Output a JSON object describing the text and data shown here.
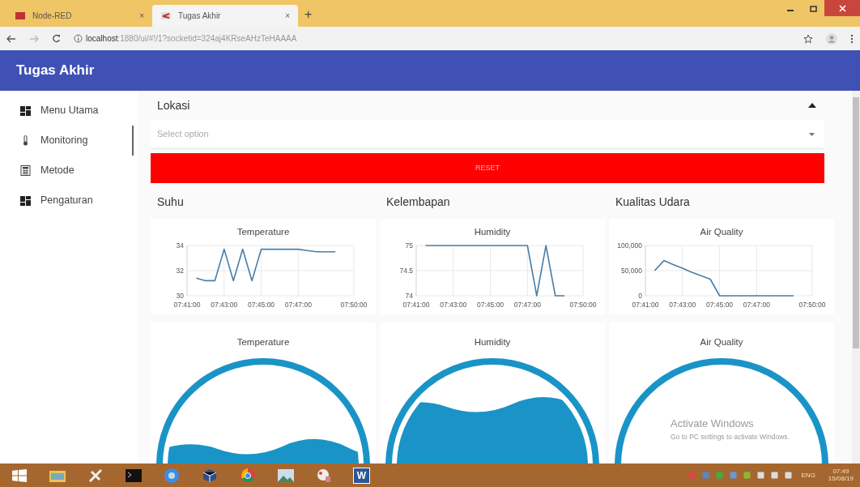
{
  "browser": {
    "tabs": [
      {
        "title": "Node-RED",
        "selected": false,
        "close": "×"
      },
      {
        "title": "Tugas Akhir",
        "selected": true,
        "close": "×"
      }
    ],
    "new_tab": "+",
    "address": {
      "host": "localhost",
      "path": ":1880/ui/#!/1?socketid=324aj4KRseAHzTeHAAAA"
    }
  },
  "header": {
    "title": "Tugas Akhir"
  },
  "sidebar": {
    "items": [
      {
        "label": "Menu Utama",
        "kind": "dashboard",
        "selected": false
      },
      {
        "label": "Monitoring",
        "kind": "thermometer",
        "selected": true
      },
      {
        "label": "Metode",
        "kind": "calculator",
        "selected": false
      },
      {
        "label": "Pengaturan",
        "kind": "dashboard",
        "selected": false
      }
    ]
  },
  "group": {
    "title": "Lokasi",
    "expanded": true,
    "dropdown": {
      "placeholder": "Select option"
    },
    "reset_button": "RESET"
  },
  "columns": [
    {
      "heading": "Suhu",
      "chart": {
        "chart_data": {
          "type": "line",
          "grid": true,
          "title": "Temperature",
          "categories": [
            "07:41:00",
            null,
            null,
            null,
            "07:43:00",
            null,
            null,
            null,
            "07:45:00",
            null,
            null,
            null,
            "07:47:00",
            null,
            null,
            null,
            null,
            null,
            "07:50:00"
          ],
          "series": [
            {
              "color": "#4a7fa7",
              "values": [
                null,
                31.4,
                31.2,
                31.2,
                33.7,
                31.2,
                33.7,
                31.2,
                33.7,
                33.7,
                33.7,
                33.7,
                33.7,
                33.6,
                33.5,
                33.5,
                33.5,
                null,
                null
              ]
            }
          ],
          "ylim": [
            30,
            34
          ],
          "yticks": [
            30,
            32,
            34
          ]
        }
      },
      "gauge": {
        "title": "Temperature"
      }
    },
    {
      "heading": "Kelembapan",
      "chart": {
        "chart_data": {
          "type": "line",
          "grid": true,
          "title": "Humidity",
          "categories": [
            "07:41:00",
            null,
            null,
            null,
            "07:43:00",
            null,
            null,
            null,
            "07:45:00",
            null,
            null,
            null,
            "07:47:00",
            null,
            null,
            null,
            null,
            null,
            "07:50:00"
          ],
          "series": [
            {
              "color": "#4a7fa7",
              "values": [
                null,
                75,
                75,
                75,
                75,
                75,
                75,
                75,
                75,
                75,
                75,
                75,
                75,
                74,
                75,
                74,
                74,
                null,
                null
              ]
            }
          ],
          "ylim": [
            74,
            75
          ],
          "yticks": [
            74,
            74.5,
            75
          ]
        }
      },
      "gauge": {
        "title": "Humidity"
      }
    },
    {
      "heading": "Kualitas Udara",
      "chart": {
        "chart_data": {
          "type": "line",
          "grid": true,
          "title": "Air Quality",
          "categories": [
            "07:41:00",
            null,
            null,
            null,
            "07:43:00",
            null,
            null,
            null,
            "07:45:00",
            null,
            null,
            null,
            "07:47:00",
            null,
            null,
            null,
            null,
            null,
            "07:50:00"
          ],
          "series": [
            {
              "color": "#4a7fa7",
              "values": [
                null,
                50000,
                70000,
                62000,
                55000,
                47000,
                40000,
                33000,
                0,
                0,
                0,
                0,
                0,
                0,
                0,
                0,
                0,
                null,
                null
              ]
            }
          ],
          "ylim": [
            0,
            100000
          ],
          "yticks": [
            0,
            {
              "value": 50000,
              "label": "50,000"
            },
            {
              "value": 100000,
              "label": "100,000"
            }
          ]
        }
      },
      "gauge": {
        "title": "Air Quality"
      }
    }
  ],
  "activation_notice": {
    "title": "Activate Windows",
    "subtitle": "Go to PC settings to activate Windows."
  },
  "taskbar": {
    "apps": [
      {
        "kind": "start"
      },
      {
        "kind": "folder"
      },
      {
        "kind": "tools"
      },
      {
        "kind": "terminal"
      },
      {
        "kind": "browser-blue"
      },
      {
        "kind": "cube"
      },
      {
        "kind": "browser"
      },
      {
        "kind": "picture"
      },
      {
        "kind": "paint"
      },
      {
        "kind": "document",
        "label": "W"
      }
    ],
    "language": "ENG",
    "time": "07:49",
    "date": "15/08/19"
  }
}
